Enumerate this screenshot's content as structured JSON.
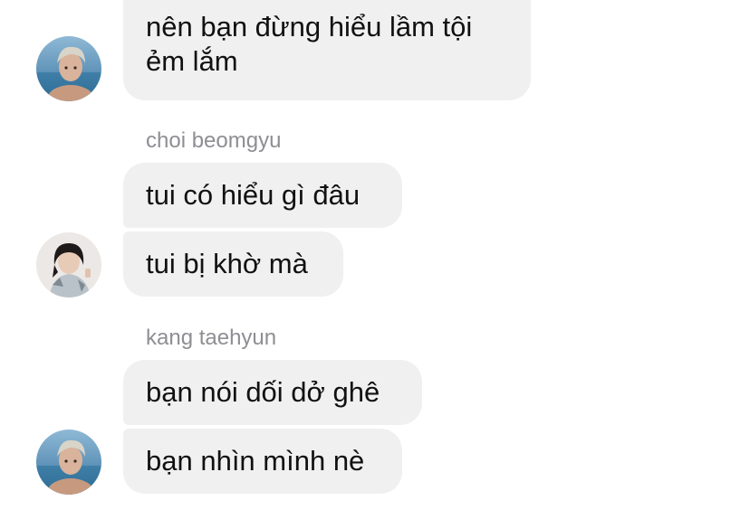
{
  "group1": {
    "message": "nên bạn đừng hiểu lầm tội ẻm lắm",
    "avatar_icon": "user-photo-avatar"
  },
  "group2": {
    "sender": "choi beomgyu",
    "messages": [
      "tui có hiểu gì đâu",
      "tui bị khờ mà"
    ],
    "avatar_icon": "user-photo-avatar"
  },
  "group3": {
    "sender": "kang taehyun",
    "messages": [
      "bạn nói dối dở ghê",
      "bạn nhìn mình nè"
    ],
    "avatar_icon": "user-photo-avatar"
  },
  "colors": {
    "bubble_bg": "#f0f0f0",
    "sender_text": "#8e8e93",
    "message_text": "#111111"
  }
}
